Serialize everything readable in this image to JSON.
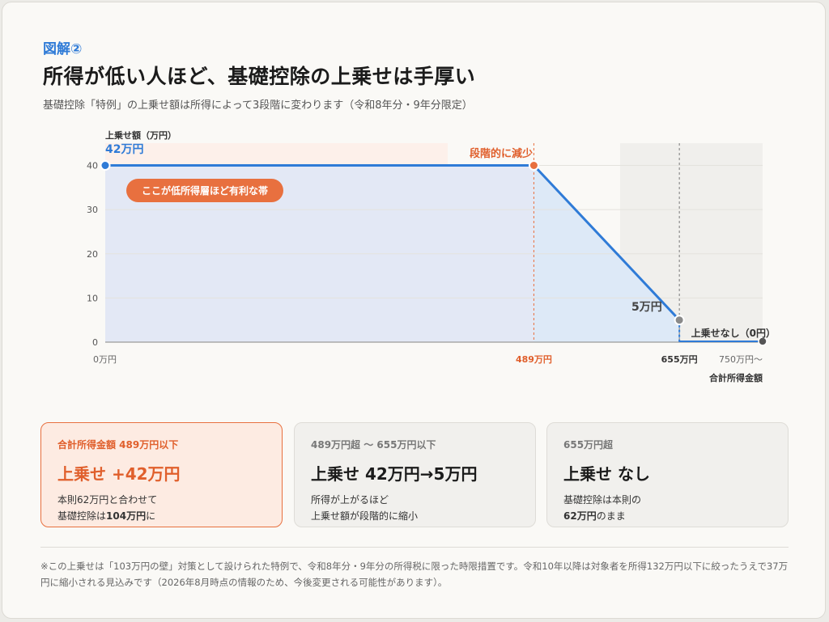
{
  "header": {
    "kicker": "図解②",
    "title": "所得が低い人ほど、基礎控除の上乗せは手厚い",
    "subtitle": "基礎控除「特例」の上乗せ額は所得によって3段階に変わります（令和8年分・9年分限定）"
  },
  "chart_data": {
    "type": "line",
    "ylabel": "上乗せ額（万円）",
    "xlabel": "合計所得金額",
    "ylim": [
      0,
      40
    ],
    "yticks": [
      0,
      10,
      20,
      30,
      40
    ],
    "xlim": [
      0,
      750
    ],
    "x_tick_labels": [
      {
        "x": 0,
        "label": "0万円"
      },
      {
        "x": 489,
        "label": "489万円"
      },
      {
        "x": 655,
        "label": "655万円"
      },
      {
        "x": 750,
        "label": "750万円〜"
      }
    ],
    "series": [
      {
        "points": [
          {
            "x": 0,
            "y": 40
          },
          {
            "x": 489,
            "y": 40
          },
          {
            "x": 655,
            "y": 5
          },
          {
            "x": 655,
            "y": 0
          },
          {
            "x": 750,
            "y": 0
          }
        ]
      }
    ],
    "annotations": {
      "top_value": "42万円",
      "badge": "ここが低所得層ほど有利な帯",
      "decrease": "段階的に減少",
      "five": "5万円",
      "none": "上乗せなし（0円）"
    },
    "colors": {
      "line": "#2f7bd7",
      "accent": "#e8703f",
      "gray": "#7a7a7a"
    }
  },
  "boxes": [
    {
      "caption": "合計所得金額 489万円以下",
      "main": "上乗せ +42万円",
      "desc_line1": "本則62万円と合わせて",
      "desc_line2_pre": "基礎控除は",
      "desc_line2_bold": "104万円",
      "desc_line2_post": "に"
    },
    {
      "caption": "489万円超 〜 655万円以下",
      "main": "上乗せ 42万円→5万円",
      "desc_line1": "所得が上がるほど",
      "desc_line2": "上乗せ額が段階的に縮小"
    },
    {
      "caption": "655万円超",
      "main": "上乗せ なし",
      "desc_line1": "基礎控除は本則の",
      "desc_line2_bold": "62万円",
      "desc_line2_post": "のまま"
    }
  ],
  "footnote": "※この上乗せは「103万円の壁」対策として設けられた特例で、令和8年分・9年分の所得税に限った時限措置です。令和10年以降は対象者を所得132万円以下に絞ったうえで37万円に縮小される見込みです（2026年8月時点の情報のため、今後変更される可能性があります）。"
}
